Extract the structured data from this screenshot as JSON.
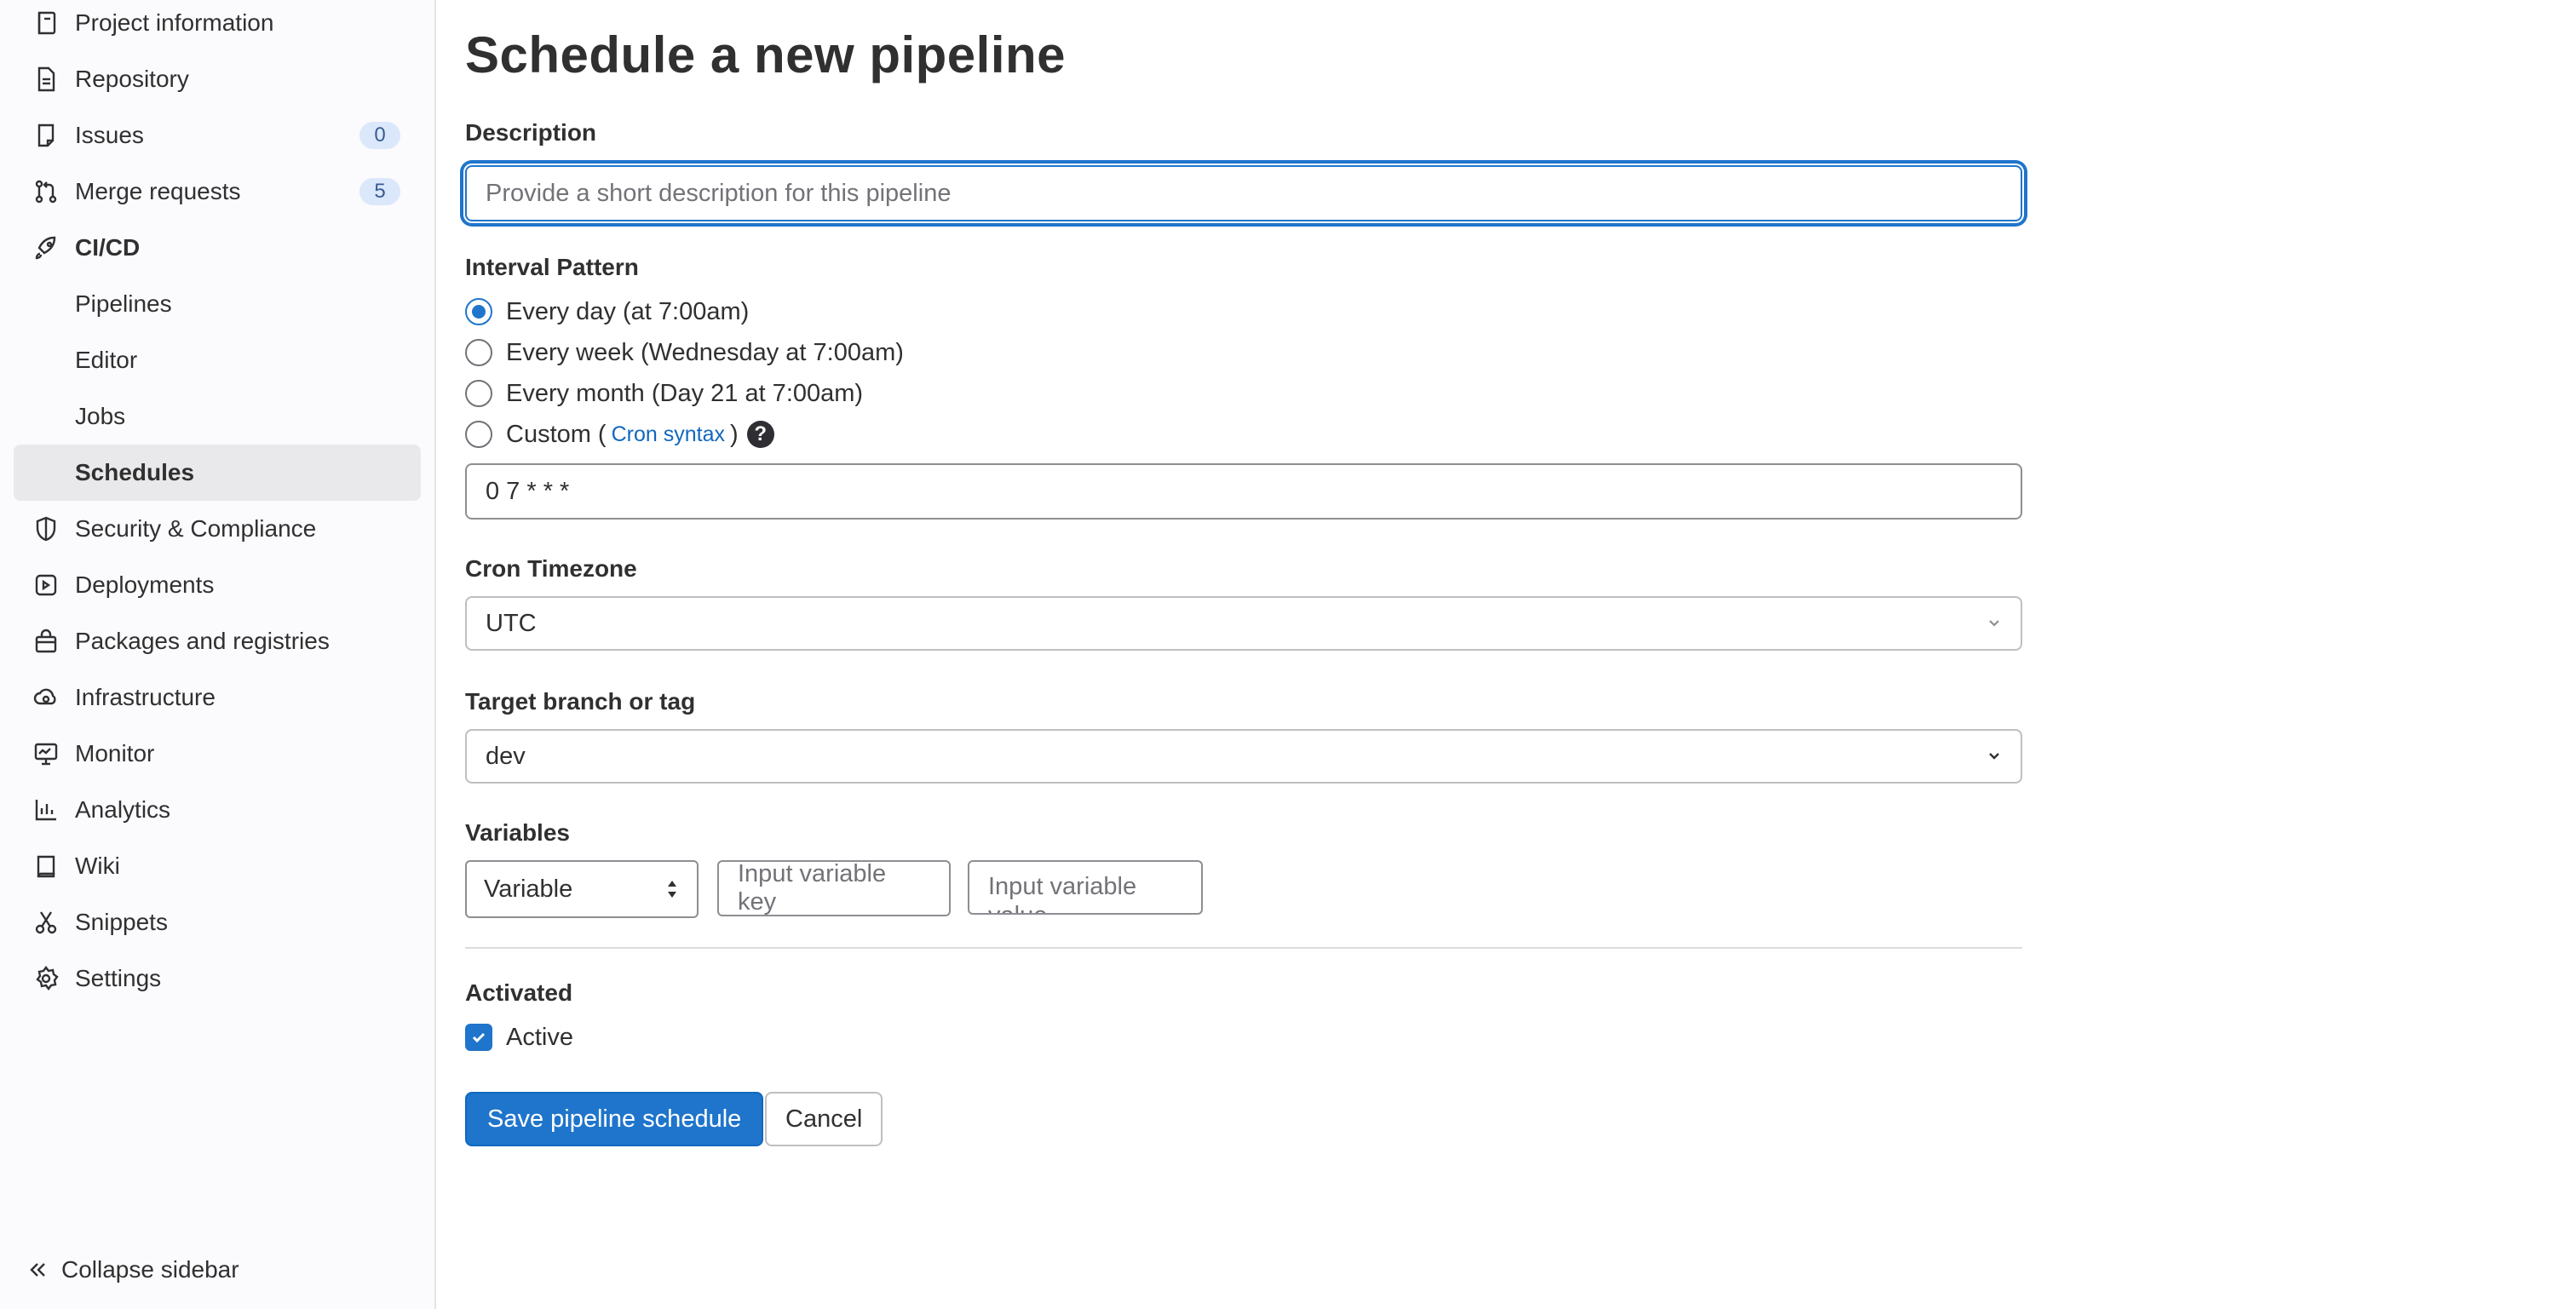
{
  "sidebar": {
    "items": [
      {
        "id": "project-information",
        "label": "Project information",
        "icon": "project-icon"
      },
      {
        "id": "repository",
        "label": "Repository",
        "icon": "document-icon"
      },
      {
        "id": "issues",
        "label": "Issues",
        "icon": "issues-icon",
        "count": "0"
      },
      {
        "id": "merge-requests",
        "label": "Merge requests",
        "icon": "merge-request-icon",
        "count": "5"
      },
      {
        "id": "cicd",
        "label": "CI/CD",
        "icon": "rocket-icon"
      },
      {
        "id": "pipelines",
        "label": "Pipelines"
      },
      {
        "id": "editor",
        "label": "Editor"
      },
      {
        "id": "jobs",
        "label": "Jobs"
      },
      {
        "id": "schedules",
        "label": "Schedules"
      },
      {
        "id": "security-compliance",
        "label": "Security & Compliance",
        "icon": "shield-icon"
      },
      {
        "id": "deployments",
        "label": "Deployments",
        "icon": "deployments-icon"
      },
      {
        "id": "packages-registries",
        "label": "Packages and registries",
        "icon": "package-icon"
      },
      {
        "id": "infrastructure",
        "label": "Infrastructure",
        "icon": "cloud-gear-icon"
      },
      {
        "id": "monitor",
        "label": "Monitor",
        "icon": "monitor-icon"
      },
      {
        "id": "analytics",
        "label": "Analytics",
        "icon": "chart-icon"
      },
      {
        "id": "wiki",
        "label": "Wiki",
        "icon": "book-icon"
      },
      {
        "id": "snippets",
        "label": "Snippets",
        "icon": "scissors-icon"
      },
      {
        "id": "settings",
        "label": "Settings",
        "icon": "gear-icon"
      }
    ],
    "collapse_label": "Collapse sidebar"
  },
  "page": {
    "title": "Schedule a new pipeline"
  },
  "form": {
    "description": {
      "label": "Description",
      "placeholder": "Provide a short description for this pipeline",
      "value": ""
    },
    "interval": {
      "label": "Interval Pattern",
      "options": [
        {
          "label": "Every day (at 7:00am)",
          "checked": true
        },
        {
          "label": "Every week (Wednesday at 7:00am)",
          "checked": false
        },
        {
          "label": "Every month (Day 21 at 7:00am)",
          "checked": false
        }
      ],
      "custom_label": "Custom",
      "custom_open": "(",
      "custom_link": "Cron syntax",
      "custom_close": ")",
      "help": "?",
      "cron_value": "0 7 * * *"
    },
    "timezone": {
      "label": "Cron Timezone",
      "value": "UTC"
    },
    "target": {
      "label": "Target branch or tag",
      "value": "dev"
    },
    "variables": {
      "label": "Variables",
      "type_value": "Variable",
      "key_placeholder": "Input variable key",
      "value_placeholder": "Input variable value"
    },
    "activated": {
      "label": "Activated",
      "checkbox_label": "Active",
      "checked": true
    },
    "buttons": {
      "save": "Save pipeline schedule",
      "cancel": "Cancel"
    }
  },
  "colors": {
    "accent": "#1f75cb",
    "link": "#1068bf",
    "badge_bg": "#dbe8fb",
    "active_nav_bg": "#e9e9ec"
  }
}
